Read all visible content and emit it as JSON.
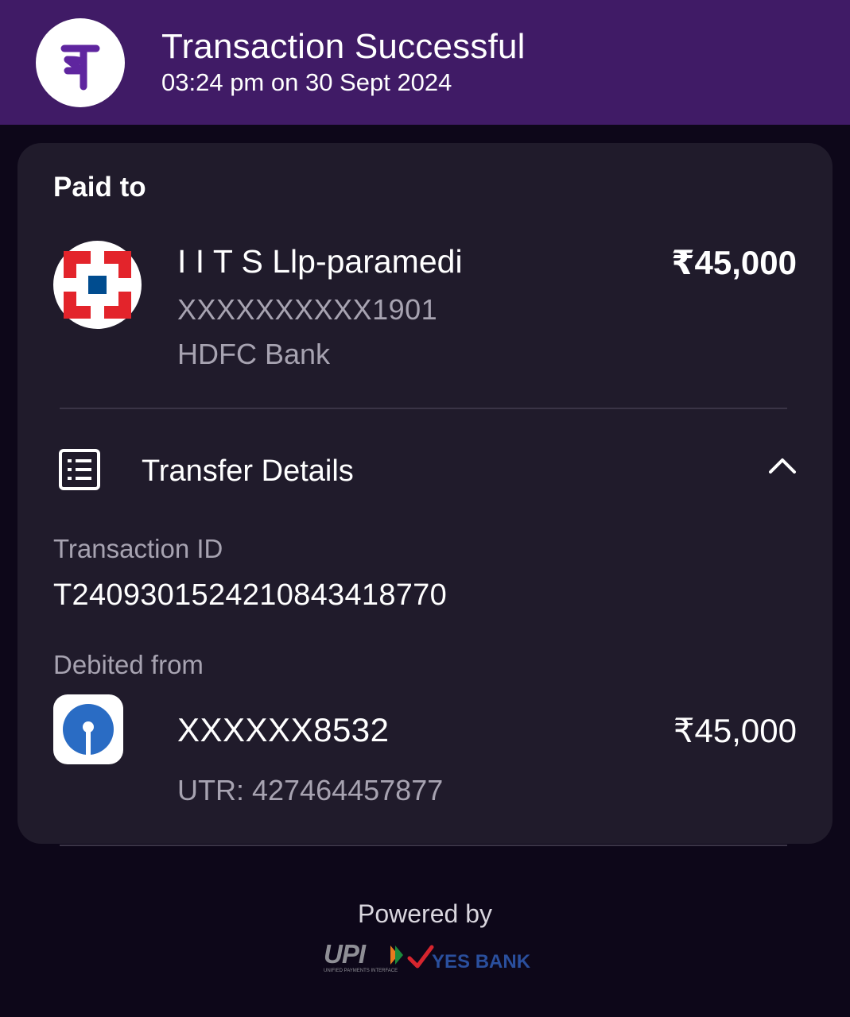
{
  "header": {
    "app_logo_icon": "phonepe-logo-icon",
    "title": "Transaction Successful",
    "time": "03:24 pm on 30 Sept 2024",
    "background": "#401b66"
  },
  "payment": {
    "section_label": "Paid to",
    "payee_logo_icon": "hdfc-bank-logo-icon",
    "payee_name": "I I T S Llp-paramedi",
    "payee_account": "XXXXXXXXXX1901",
    "payee_bank": "HDFC Bank",
    "amount": "₹45,000"
  },
  "transfer_details": {
    "icon": "receipt-list-icon",
    "title": "Transfer Details",
    "expand_icon": "chevron-up-icon",
    "transaction_id_label": "Transaction ID",
    "transaction_id": "T2409301524210843418770",
    "debited_from_label": "Debited from",
    "debit_logo_icon": "sbi-logo-icon",
    "debit_account": "XXXXXX8532",
    "debit_amount": "₹45,000",
    "utr": "UTR: 427464457877"
  },
  "footer": {
    "powered_by": "Powered by",
    "upi_logo": "UPI",
    "upi_tagline": "UNIFIED PAYMENTS INTERFACE",
    "bank_logo": "YES BANK"
  }
}
